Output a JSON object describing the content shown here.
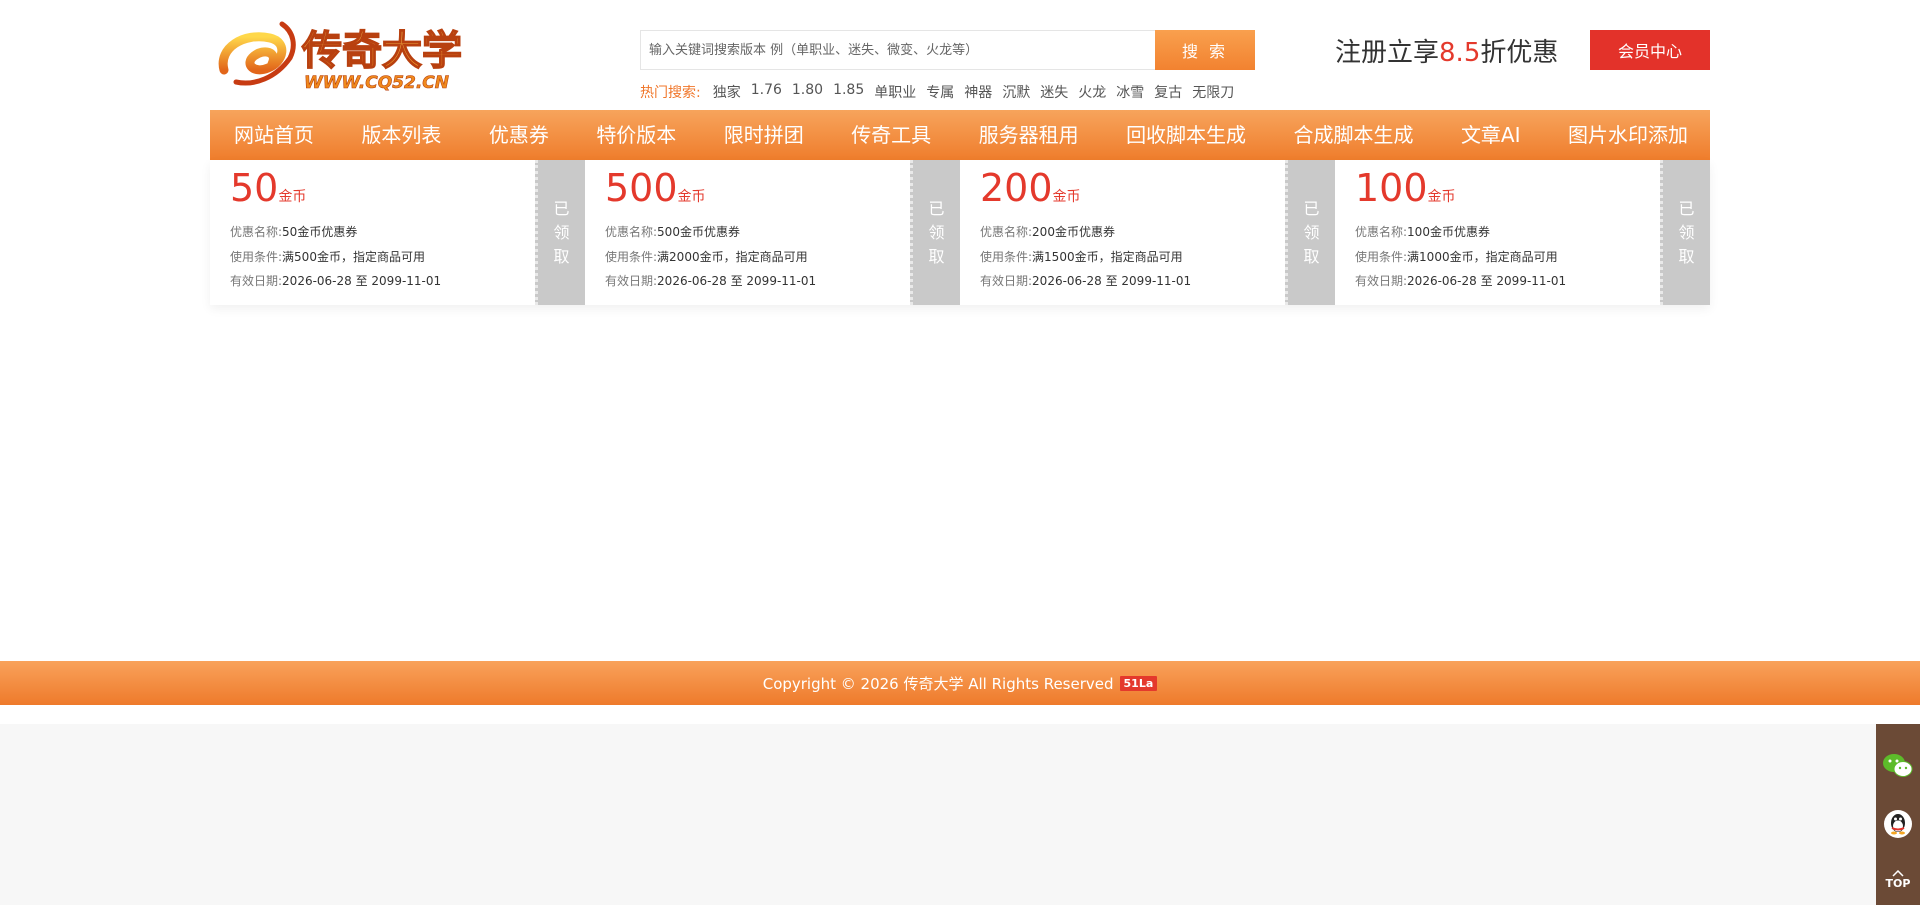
{
  "header": {
    "logo_alt": "传奇大学",
    "logo_url": "WWW.CQ52.CN",
    "search_placeholder": "输入关键词搜索版本 例（单职业、迷失、微变、火龙等）",
    "search_button": "搜 索",
    "hot_label": "热门搜索:",
    "hot_items": [
      "独家",
      "1.76",
      "1.80",
      "1.85",
      "单职业",
      "专属",
      "神器",
      "沉默",
      "迷失",
      "火龙",
      "冰雪",
      "复古",
      "无限刀"
    ],
    "promo_prefix": "注册立享",
    "promo_rate": "8.5",
    "promo_suffix": "折优惠",
    "member_button": "会员中心",
    "colors": {
      "accent": "#f28230",
      "red": "#e3322a"
    }
  },
  "nav": {
    "items": [
      "网站首页",
      "版本列表",
      "优惠券",
      "特价版本",
      "限时拼团",
      "传奇工具",
      "服务器租用",
      "回收脚本生成",
      "合成脚本生成",
      "文章AI",
      "图片水印添加"
    ]
  },
  "coupons": [
    {
      "amount": "50",
      "unit": "金币",
      "name_label": "优惠名称:",
      "name": "50金币优惠券",
      "cond_label": "使用条件:",
      "cond": "满500金币，指定商品可用",
      "date_label": "有效日期:",
      "date": "2026-06-28 至 2099-11-01",
      "status": [
        "已",
        "领",
        "取"
      ]
    },
    {
      "amount": "500",
      "unit": "金币",
      "name_label": "优惠名称:",
      "name": "500金币优惠券",
      "cond_label": "使用条件:",
      "cond": "满2000金币，指定商品可用",
      "date_label": "有效日期:",
      "date": "2026-06-28 至 2099-11-01",
      "status": [
        "已",
        "领",
        "取"
      ]
    },
    {
      "amount": "200",
      "unit": "金币",
      "name_label": "优惠名称:",
      "name": "200金币优惠券",
      "cond_label": "使用条件:",
      "cond": "满1500金币，指定商品可用",
      "date_label": "有效日期:",
      "date": "2026-06-28 至 2099-11-01",
      "status": [
        "已",
        "领",
        "取"
      ]
    },
    {
      "amount": "100",
      "unit": "金币",
      "name_label": "优惠名称:",
      "name": "100金币优惠券",
      "cond_label": "使用条件:",
      "cond": "满1000金币，指定商品可用",
      "date_label": "有效日期:",
      "date": "2026-06-28 至 2099-11-01",
      "status": [
        "已",
        "领",
        "取"
      ]
    }
  ],
  "footer": {
    "copyright": "Copyright © 2026 传奇大学 All Rights Reserved",
    "badge": "51La"
  },
  "side_tools": {
    "wechat_icon": "wechat-icon",
    "qq_icon": "qq-icon",
    "top_label": "TOP"
  }
}
